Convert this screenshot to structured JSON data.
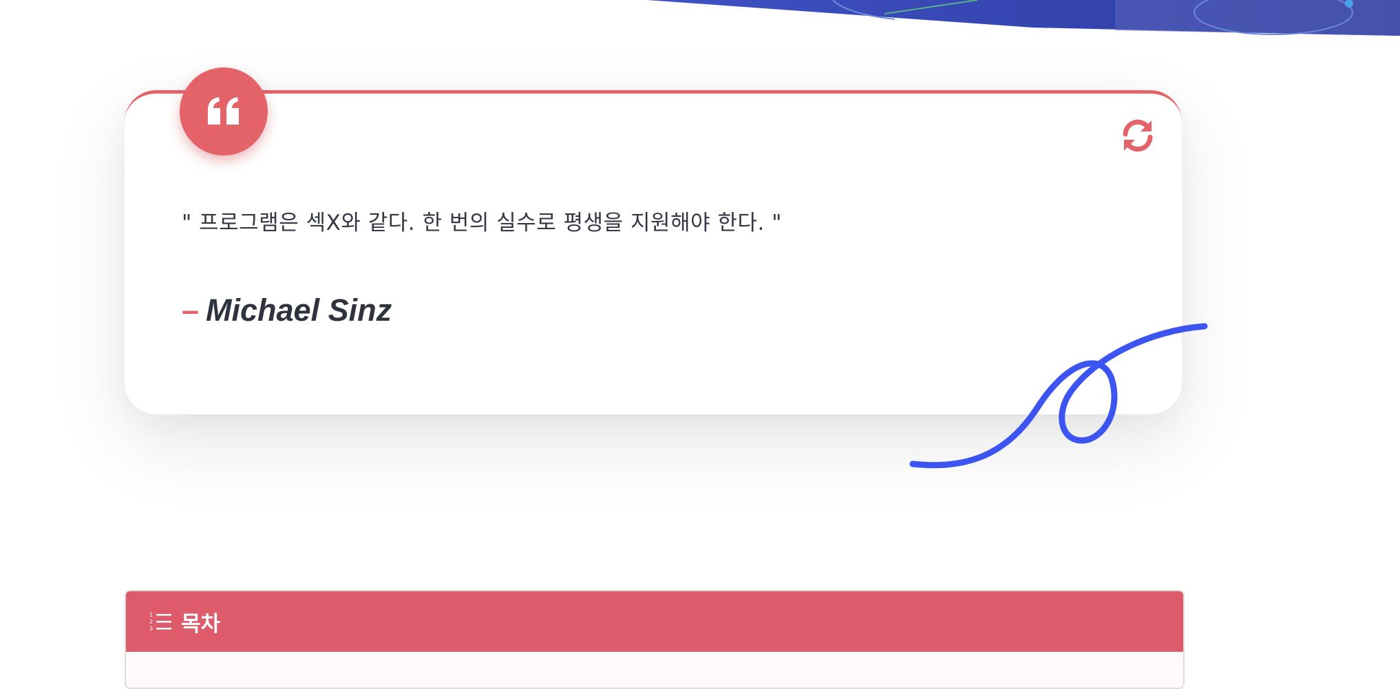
{
  "quote": {
    "text": "\" 프로그램은 섹X와 같다. 한 번의 실수로 평생을 지원해야 한다. \"",
    "dash": "–",
    "author": "Michael Sinz"
  },
  "toc": {
    "title": "목차"
  },
  "colors": {
    "accent": "#e46369",
    "toc_header": "#de5b6c",
    "squiggle": "#3d55f0",
    "banner": "#3949ab"
  },
  "icons": {
    "quote_badge": "quote-left-icon",
    "refresh": "refresh-icon",
    "toc": "list-ol-icon"
  }
}
